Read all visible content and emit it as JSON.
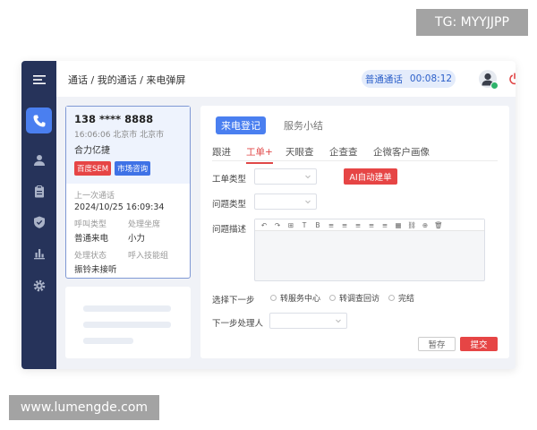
{
  "watermarks": {
    "top_right": "TG: MYYJJPP",
    "bottom_left": "www.lumengde.com"
  },
  "sidebar": {
    "items": [
      {
        "icon": "menu-icon",
        "active": false
      },
      {
        "icon": "phone-icon",
        "active": true
      },
      {
        "icon": "user-icon",
        "active": false
      },
      {
        "icon": "clipboard-icon",
        "active": false
      },
      {
        "icon": "shield-icon",
        "active": false
      },
      {
        "icon": "bar-chart-icon",
        "active": false
      },
      {
        "icon": "gear-icon",
        "active": false
      }
    ],
    "accent": "#4a7ff0",
    "background": "#26335a"
  },
  "header": {
    "breadcrumb": "通话 / 我的通话 / 来电弹屏",
    "call_type": "普通通话",
    "call_timer": "00:08:12"
  },
  "caller_card": {
    "phone": "138 **** 8888",
    "meta": "16:06:06  北京市 北京市",
    "company": "合力亿捷",
    "tags": [
      "百度SEM",
      "市场咨询"
    ],
    "last_call_label": "上一次通话",
    "last_call_value": "2024/10/25  16:09:34",
    "call_type_label": "呼叫类型",
    "call_type_value": "普通来电",
    "agent_label": "处理坐席",
    "agent_value": "小力",
    "status_label": "处理状态",
    "status_value": "振铃未接听",
    "skill_label": "呼入技能组",
    "skill_value": ""
  },
  "main": {
    "top_tabs": [
      "来电登记",
      "服务小结"
    ],
    "sub_tabs": [
      "跟进",
      "工单+",
      "天眼查",
      "企查查",
      "企微客户画像"
    ],
    "active_sub_tab": 1,
    "form": {
      "ticket_type_label": "工单类型",
      "issue_type_label": "问题类型",
      "issue_desc_label": "问题描述",
      "ai_button": "AI自动建单",
      "next_step_label": "选择下一步",
      "next_step_options": [
        "转服务中心",
        "转调查回访",
        "完结"
      ],
      "next_handler_label": "下一步处理人",
      "save_label": "暂存",
      "submit_label": "提交"
    },
    "editor_tools": [
      "↶",
      "↷",
      "⊞",
      "T",
      "B",
      "≡",
      "≡",
      "≡",
      "≡",
      "≡",
      "▦",
      "⛓",
      "⊕",
      "🗑"
    ]
  }
}
